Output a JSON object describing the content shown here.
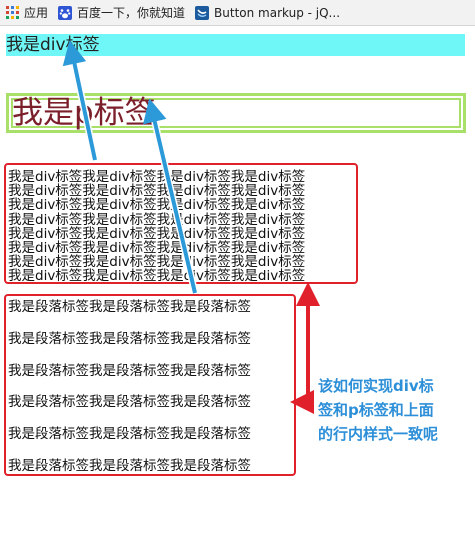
{
  "bookmarks": {
    "items": [
      {
        "label": "应用",
        "icon": "apps-grid-icon"
      },
      {
        "label": "百度一下，你就知道",
        "icon": "baidu-paw-icon"
      },
      {
        "label": "Button markup - jQ...",
        "icon": "jquery-icon"
      }
    ]
  },
  "content": {
    "div_cyan_text": "我是div标签",
    "p_green_text": "我是p标签",
    "div_lines": [
      "我是div标签我是div标签我是div标签我是div标签",
      "我是div标签我是div标签我是div标签我是div标签",
      "我是div标签我是div标签我是div标签我是div标签",
      "我是div标签我是div标签我是div标签我是div标签",
      "我是div标签我是div标签我是div标签我是div标签",
      "我是div标签我是div标签我是div标签我是div标签",
      "我是div标签我是div标签我是div标签我是div标签",
      "我是div标签我是div标签我是div标签我是div标签"
    ],
    "p_lines": [
      "我是段落标签我是段落标签我是段落标签",
      "我是段落标签我是段落标签我是段落标签",
      "我是段落标签我是段落标签我是段落标签",
      "我是段落标签我是段落标签我是段落标签",
      "我是段落标签我是段落标签我是段落标签",
      "我是段落标签我是段落标签我是段落标签"
    ]
  },
  "annotation": {
    "lines": [
      "该如何实现div标",
      "签和p标签和上面",
      "的行内样式一致呢"
    ],
    "color": "#2c8fd8"
  },
  "colors": {
    "cyan_bg": "#6ff7f7",
    "green_border": "#a8e06a",
    "red_border": "#e0202a",
    "p_text": "#7b1f2a",
    "blue_arrow": "#2c9ad8",
    "red_arrow": "#e0202a"
  }
}
